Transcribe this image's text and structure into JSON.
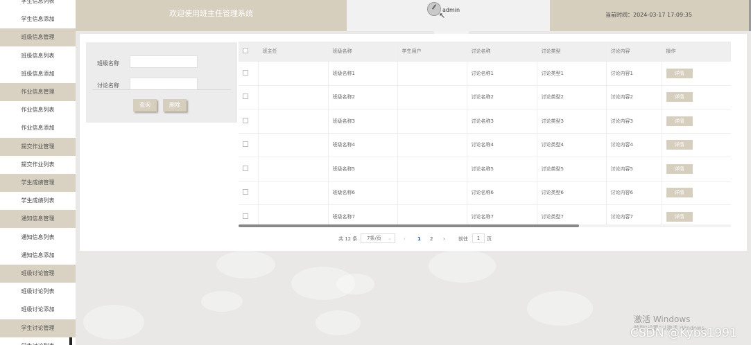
{
  "sidebar": {
    "items": [
      {
        "label": "学生信息列表",
        "group": false
      },
      {
        "label": "学生信息添加",
        "group": false
      },
      {
        "label": "班级信息管理",
        "group": true
      },
      {
        "label": "班级信息列表",
        "group": false
      },
      {
        "label": "班级信息添加",
        "group": false
      },
      {
        "label": "作业信息管理",
        "group": true
      },
      {
        "label": "作业信息列表",
        "group": false
      },
      {
        "label": "作业信息添加",
        "group": false
      },
      {
        "label": "提交作业管理",
        "group": true
      },
      {
        "label": "提交作业列表",
        "group": false
      },
      {
        "label": "学生成绩管理",
        "group": true
      },
      {
        "label": "学生成绩列表",
        "group": false
      },
      {
        "label": "通知信息管理",
        "group": true
      },
      {
        "label": "通知信息列表",
        "group": false
      },
      {
        "label": "通知信息添加",
        "group": false
      },
      {
        "label": "班级讨论管理",
        "group": true
      },
      {
        "label": "班级讨论列表",
        "group": false
      },
      {
        "label": "班级讨论添加",
        "group": false
      },
      {
        "label": "学生讨论管理",
        "group": true
      },
      {
        "label": "学生讨论列表",
        "group": false
      }
    ]
  },
  "header": {
    "title": "欢迎使用班主任管理系统",
    "username": "admin",
    "current_time": "当前时间：2024-03-17 17:09:35"
  },
  "search": {
    "class_name_label": "班级名称",
    "discussion_name_label": "讨论名称",
    "class_name_value": "",
    "discussion_name_value": "",
    "query_button": "查询",
    "delete_button": "删除"
  },
  "table": {
    "headers": [
      "班主任",
      "班级名称",
      "学生用户",
      "讨论名称",
      "讨论类型",
      "讨论内容",
      "操作"
    ],
    "rows": [
      {
        "teacher": "",
        "class_name": "班级名称1",
        "student": "",
        "discussion_name": "讨论名称1",
        "discussion_type": "讨论类型1",
        "discussion_content": "讨论内容1",
        "action": "详情"
      },
      {
        "teacher": "",
        "class_name": "班级名称2",
        "student": "",
        "discussion_name": "讨论名称2",
        "discussion_type": "讨论类型2",
        "discussion_content": "讨论内容2",
        "action": "详情"
      },
      {
        "teacher": "",
        "class_name": "班级名称3",
        "student": "",
        "discussion_name": "讨论名称3",
        "discussion_type": "讨论类型3",
        "discussion_content": "讨论内容3",
        "action": "详情"
      },
      {
        "teacher": "",
        "class_name": "班级名称4",
        "student": "",
        "discussion_name": "讨论名称4",
        "discussion_type": "讨论类型4",
        "discussion_content": "讨论内容4",
        "action": "详情"
      },
      {
        "teacher": "",
        "class_name": "班级名称5",
        "student": "",
        "discussion_name": "讨论名称5",
        "discussion_type": "讨论类型5",
        "discussion_content": "讨论内容5",
        "action": "详情"
      },
      {
        "teacher": "",
        "class_name": "班级名称6",
        "student": "",
        "discussion_name": "讨论名称6",
        "discussion_type": "讨论类型6",
        "discussion_content": "讨论内容6",
        "action": "详情"
      },
      {
        "teacher": "",
        "class_name": "班级名称7",
        "student": "",
        "discussion_name": "讨论名称7",
        "discussion_type": "讨论类型7",
        "discussion_content": "讨论内容7",
        "action": "详情"
      }
    ]
  },
  "pagination": {
    "total": "共 12 条",
    "page_size": "7条/页",
    "prev": "‹",
    "pages": [
      "1",
      "2"
    ],
    "current_page": "1",
    "next": "›",
    "goto_label": "前往",
    "goto_value": "1",
    "page_suffix": "页"
  },
  "watermarks": {
    "windows_line1": "激活 Windows",
    "windows_line2": "转到\"设置\"以激活 Windows。",
    "csdn": "CSDN @Kybs1991"
  },
  "colors": {
    "accent": "#d6cfbe",
    "sidebar_group": "#d9d2c2",
    "current_page": "#1e4fa0"
  }
}
